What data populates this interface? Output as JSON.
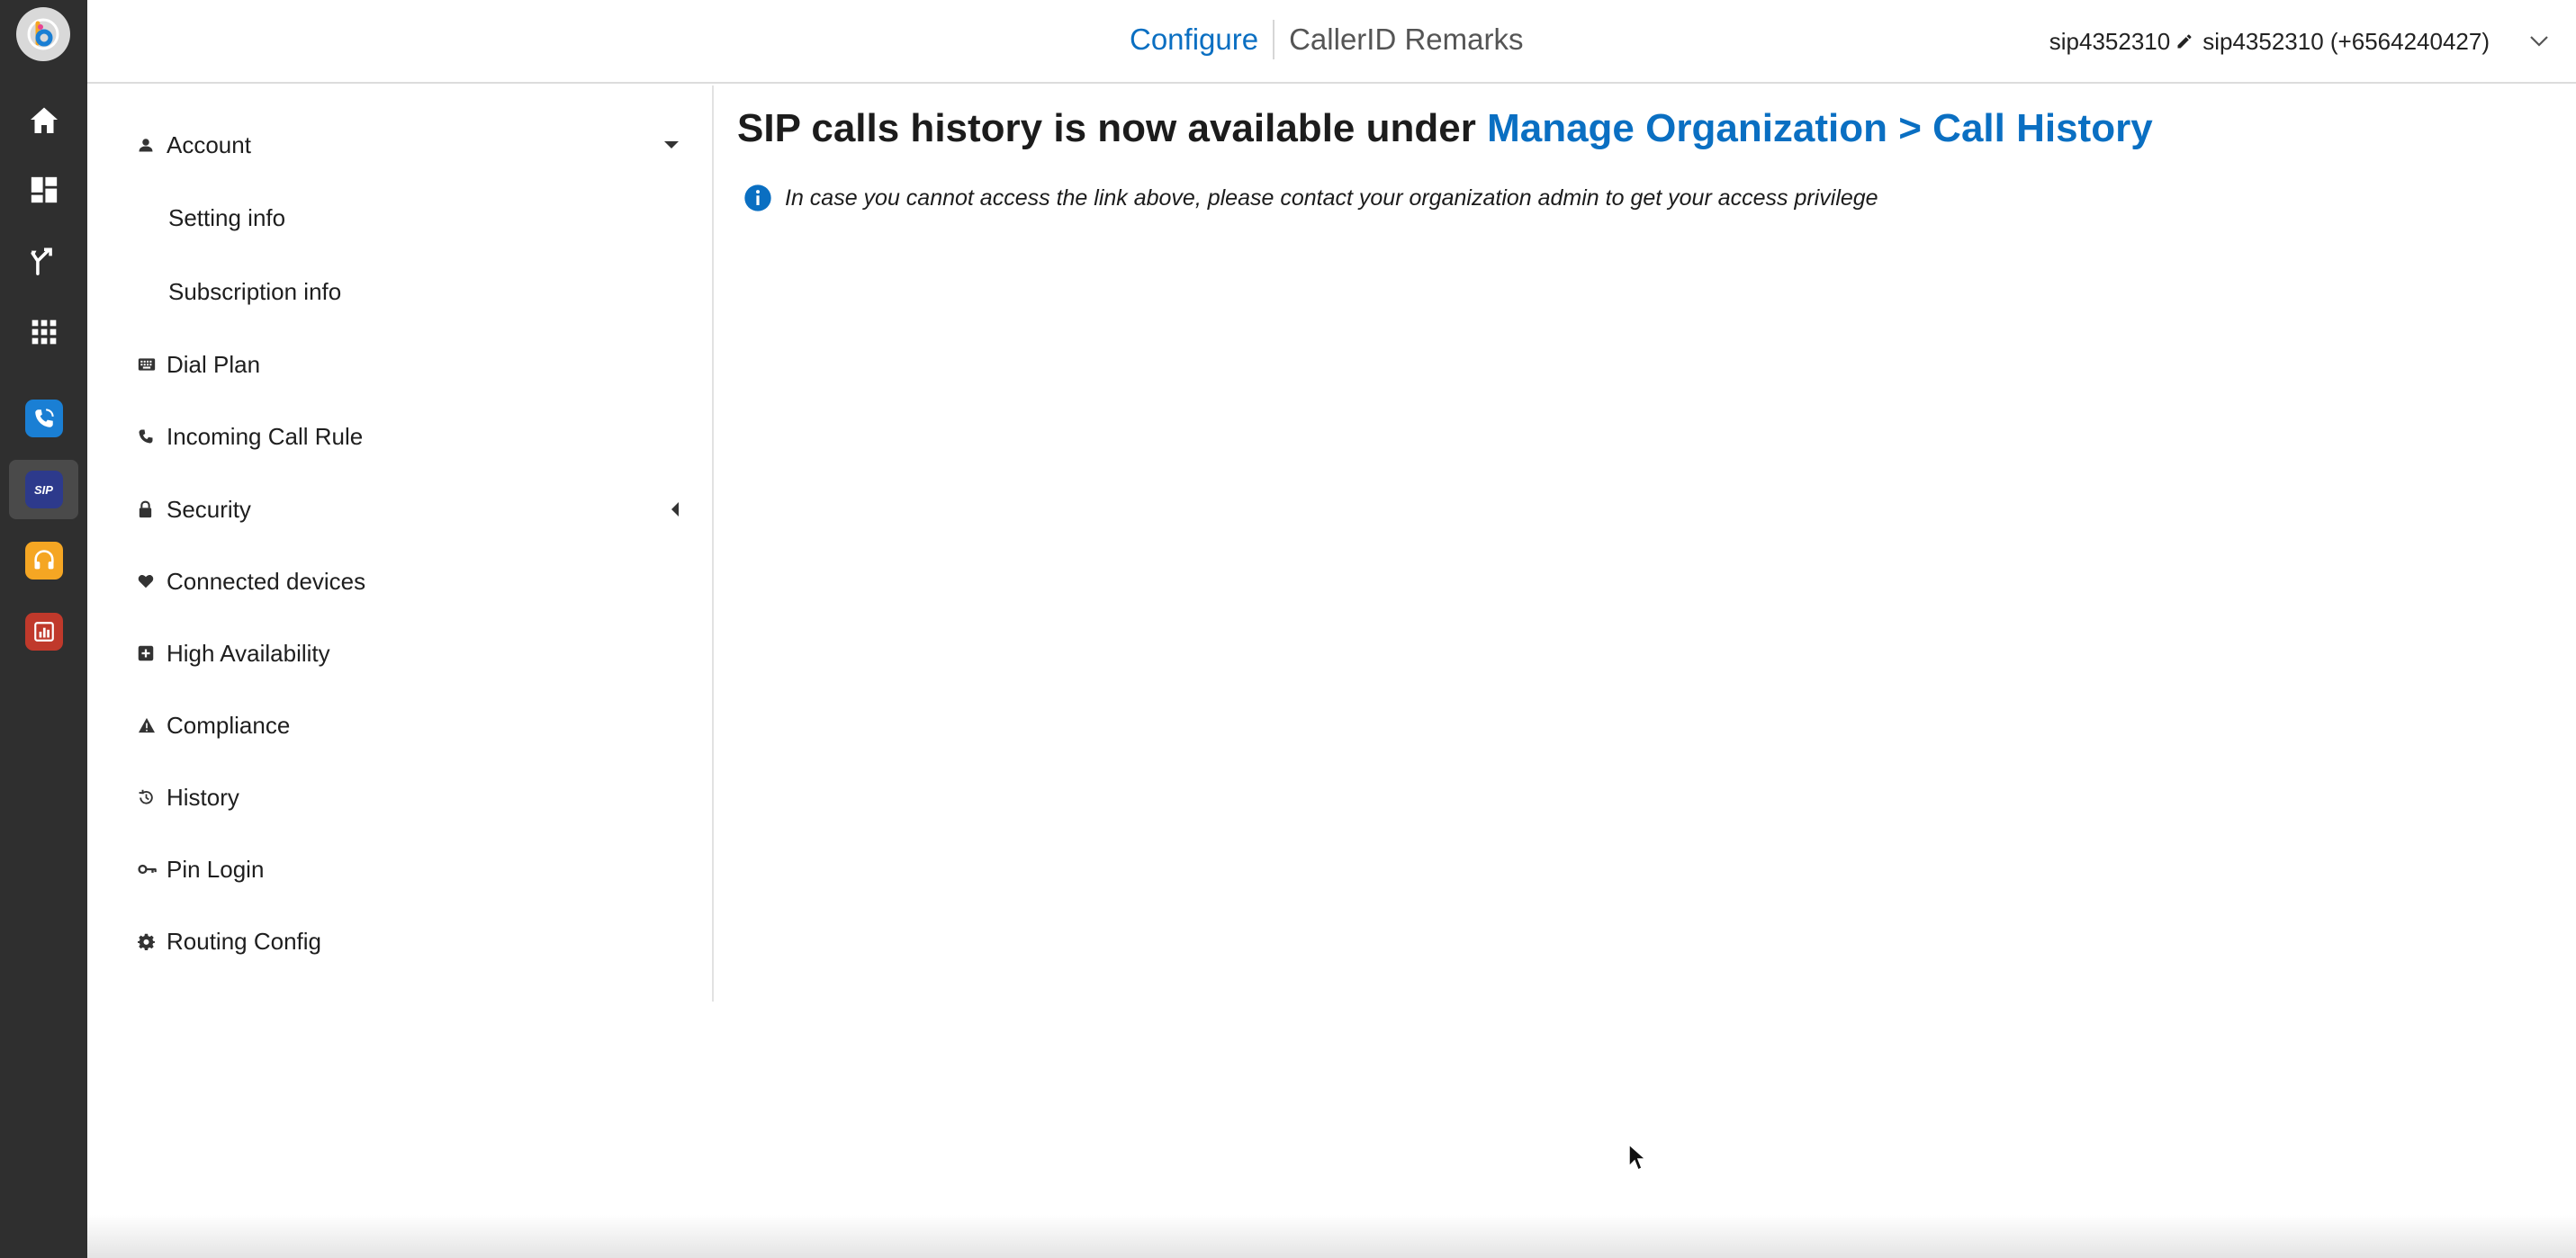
{
  "header": {
    "configure_label": "Configure",
    "callerid_label": "CallerID Remarks",
    "account_name": "sip4352310",
    "account_display": "sip4352310 (+6564240427)"
  },
  "rail": {
    "items": [
      {
        "icon": "home-icon"
      },
      {
        "icon": "dashboard-icon"
      },
      {
        "icon": "routing-icon"
      },
      {
        "icon": "apps-grid-icon"
      },
      {
        "icon": "phone-app-icon",
        "color": "#1a7fd4"
      },
      {
        "icon": "sip-app-icon",
        "color": "#2d3a8c",
        "label": "SIP",
        "active": true
      },
      {
        "icon": "headset-app-icon",
        "color": "#f5a623"
      },
      {
        "icon": "report-app-icon",
        "color": "#c0392b"
      }
    ]
  },
  "sidebar": {
    "items": [
      {
        "label": "Account",
        "icon": "user-icon",
        "expanded": true
      },
      {
        "label": "Setting info",
        "sub": true
      },
      {
        "label": "Subscription info",
        "sub": true
      },
      {
        "label": "Dial Plan",
        "icon": "keyboard-icon"
      },
      {
        "label": "Incoming Call Rule",
        "icon": "phone-icon"
      },
      {
        "label": "Security",
        "icon": "lock-icon",
        "collapsed": true
      },
      {
        "label": "Connected devices",
        "icon": "heart-icon"
      },
      {
        "label": "High Availability",
        "icon": "plus-box-icon"
      },
      {
        "label": "Compliance",
        "icon": "warning-icon"
      },
      {
        "label": "History",
        "icon": "history-icon"
      },
      {
        "label": "Pin Login",
        "icon": "key-icon"
      },
      {
        "label": "Routing Config",
        "icon": "gear-icon"
      }
    ]
  },
  "main": {
    "title_prefix": "SIP calls history is now available under",
    "title_link": "Manage Organization > Call History",
    "info_text": "In case you cannot access the link above, please contact your organization admin to get your access privilege"
  },
  "colors": {
    "accent": "#0a6fc2",
    "rail_bg": "#2f2f2f"
  }
}
